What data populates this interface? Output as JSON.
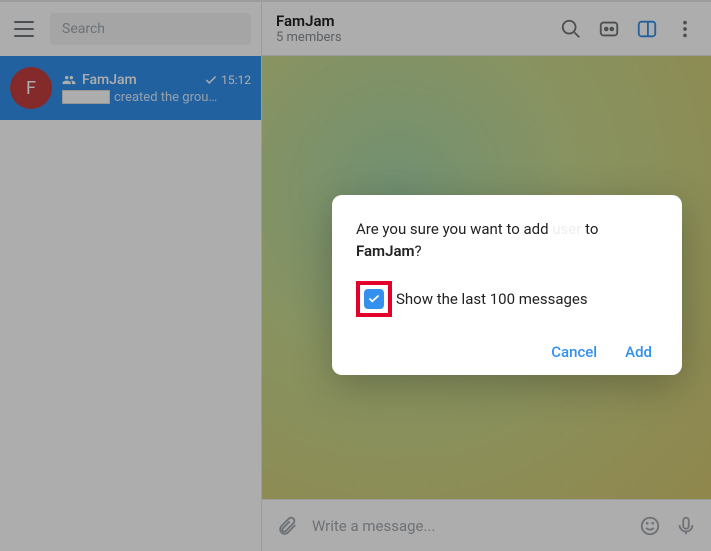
{
  "sidebar": {
    "search_placeholder": "Search",
    "chat": {
      "avatar_letter": "F",
      "name": "FamJam",
      "time": "15:12",
      "snippet_suffix": "created the grou…"
    }
  },
  "header": {
    "title": "FamJam",
    "subtitle": "5 members"
  },
  "composer": {
    "placeholder": "Write a message..."
  },
  "dialog": {
    "line_prefix": "Are you sure you want to add ",
    "line_mid_ghost": "user",
    "line_to": " to ",
    "group_name": "FamJam",
    "question_mark": "?",
    "checkbox_label": "Show the last 100 messages",
    "cancel": "Cancel",
    "add": "Add"
  }
}
